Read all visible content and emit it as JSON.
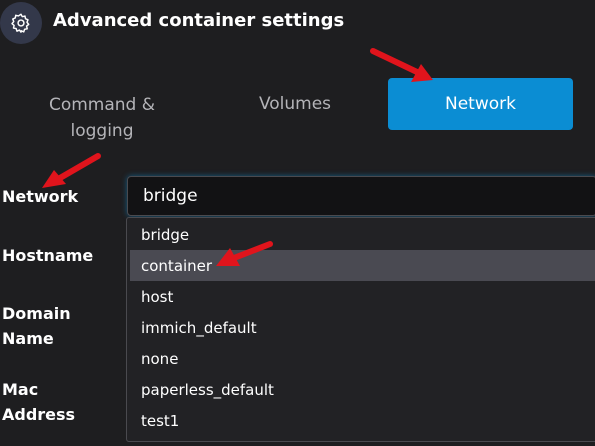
{
  "header": {
    "title": "Advanced container settings",
    "icon": "gear-icon"
  },
  "tabs": [
    {
      "label": "Command &\nlogging",
      "active": false
    },
    {
      "label": "Volumes",
      "active": false
    },
    {
      "label": "Network",
      "active": true
    }
  ],
  "form": {
    "network_label": "Network",
    "network_value": "bridge",
    "hostname_label": "Hostname",
    "domain_label": "Domain\nName",
    "mac_label": "Mac\nAddress"
  },
  "dropdown": {
    "options": [
      "bridge",
      "container",
      "host",
      "immich_default",
      "none",
      "paperless_default",
      "test1"
    ],
    "highlighted": "container"
  },
  "colors": {
    "background": "#1e1e20",
    "accent": "#0b8dd3",
    "annotation_arrow": "#e0141c",
    "highlight": "#4a4a52"
  }
}
